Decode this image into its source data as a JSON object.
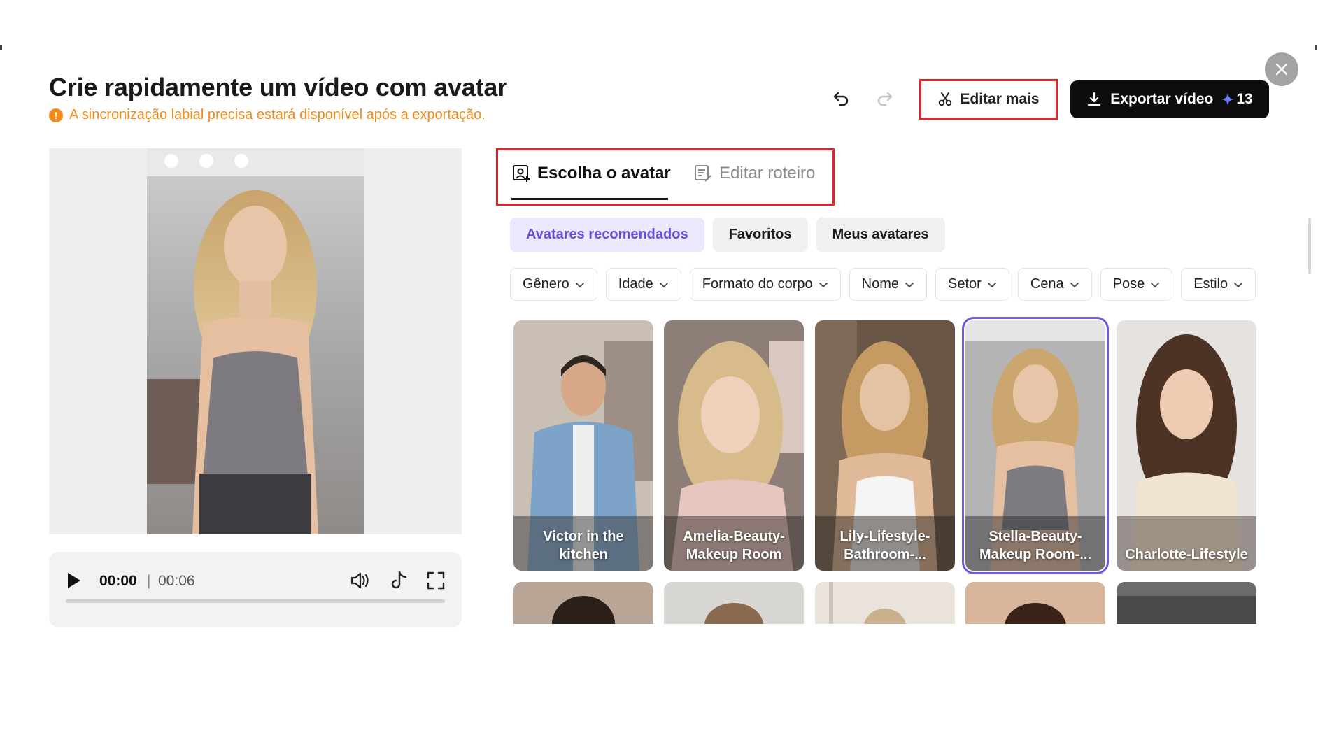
{
  "header": {
    "title": "Crie rapidamente um vídeo com avatar",
    "notice": "A sincronização labial precisa estará disponível após a exportação.",
    "notice_icon": "!",
    "edit_more_label": "Editar mais",
    "export_label": "Exportar vídeo",
    "export_credits": "13"
  },
  "player": {
    "current_time": "00:00",
    "separator": "|",
    "duration": "00:06",
    "progress": 0.0
  },
  "tabs": [
    {
      "label": "Escolha o avatar",
      "active": true
    },
    {
      "label": "Editar roteiro",
      "active": false
    }
  ],
  "chips": [
    {
      "label": "Avatares recomendados",
      "active": true
    },
    {
      "label": "Favoritos",
      "active": false
    },
    {
      "label": "Meus avatares",
      "active": false
    }
  ],
  "filters": [
    "Gênero",
    "Idade",
    "Formato do corpo",
    "Nome",
    "Setor",
    "Cena",
    "Pose",
    "Estilo"
  ],
  "avatars": [
    {
      "label": "Victor in the kitchen",
      "selected": false
    },
    {
      "label": "Amelia-Beauty-Makeup Room",
      "selected": false
    },
    {
      "label": "Lily-Lifestyle-Bathroom-...",
      "selected": false
    },
    {
      "label": "Stella-Beauty-Makeup Room-...",
      "selected": true
    },
    {
      "label": "Charlotte-Lifestyle",
      "selected": false
    }
  ],
  "colors": {
    "accent": "#6b5be0",
    "highlight_border": "#e0242c",
    "notice": "#f08c1a",
    "export_bg": "#0d0d0d"
  },
  "icons": {
    "close": "close-icon",
    "undo": "undo-icon",
    "redo": "redo-icon",
    "scissors": "scissors-icon",
    "download": "download-icon",
    "sparkle": "sparkle-icon",
    "play": "play-icon",
    "volume": "volume-icon",
    "tiktok": "tiktok-icon",
    "fullscreen": "fullscreen-icon",
    "avatar_tab": "person-frame-icon",
    "script_tab": "script-edit-icon",
    "chevron": "chevron-down-icon"
  }
}
